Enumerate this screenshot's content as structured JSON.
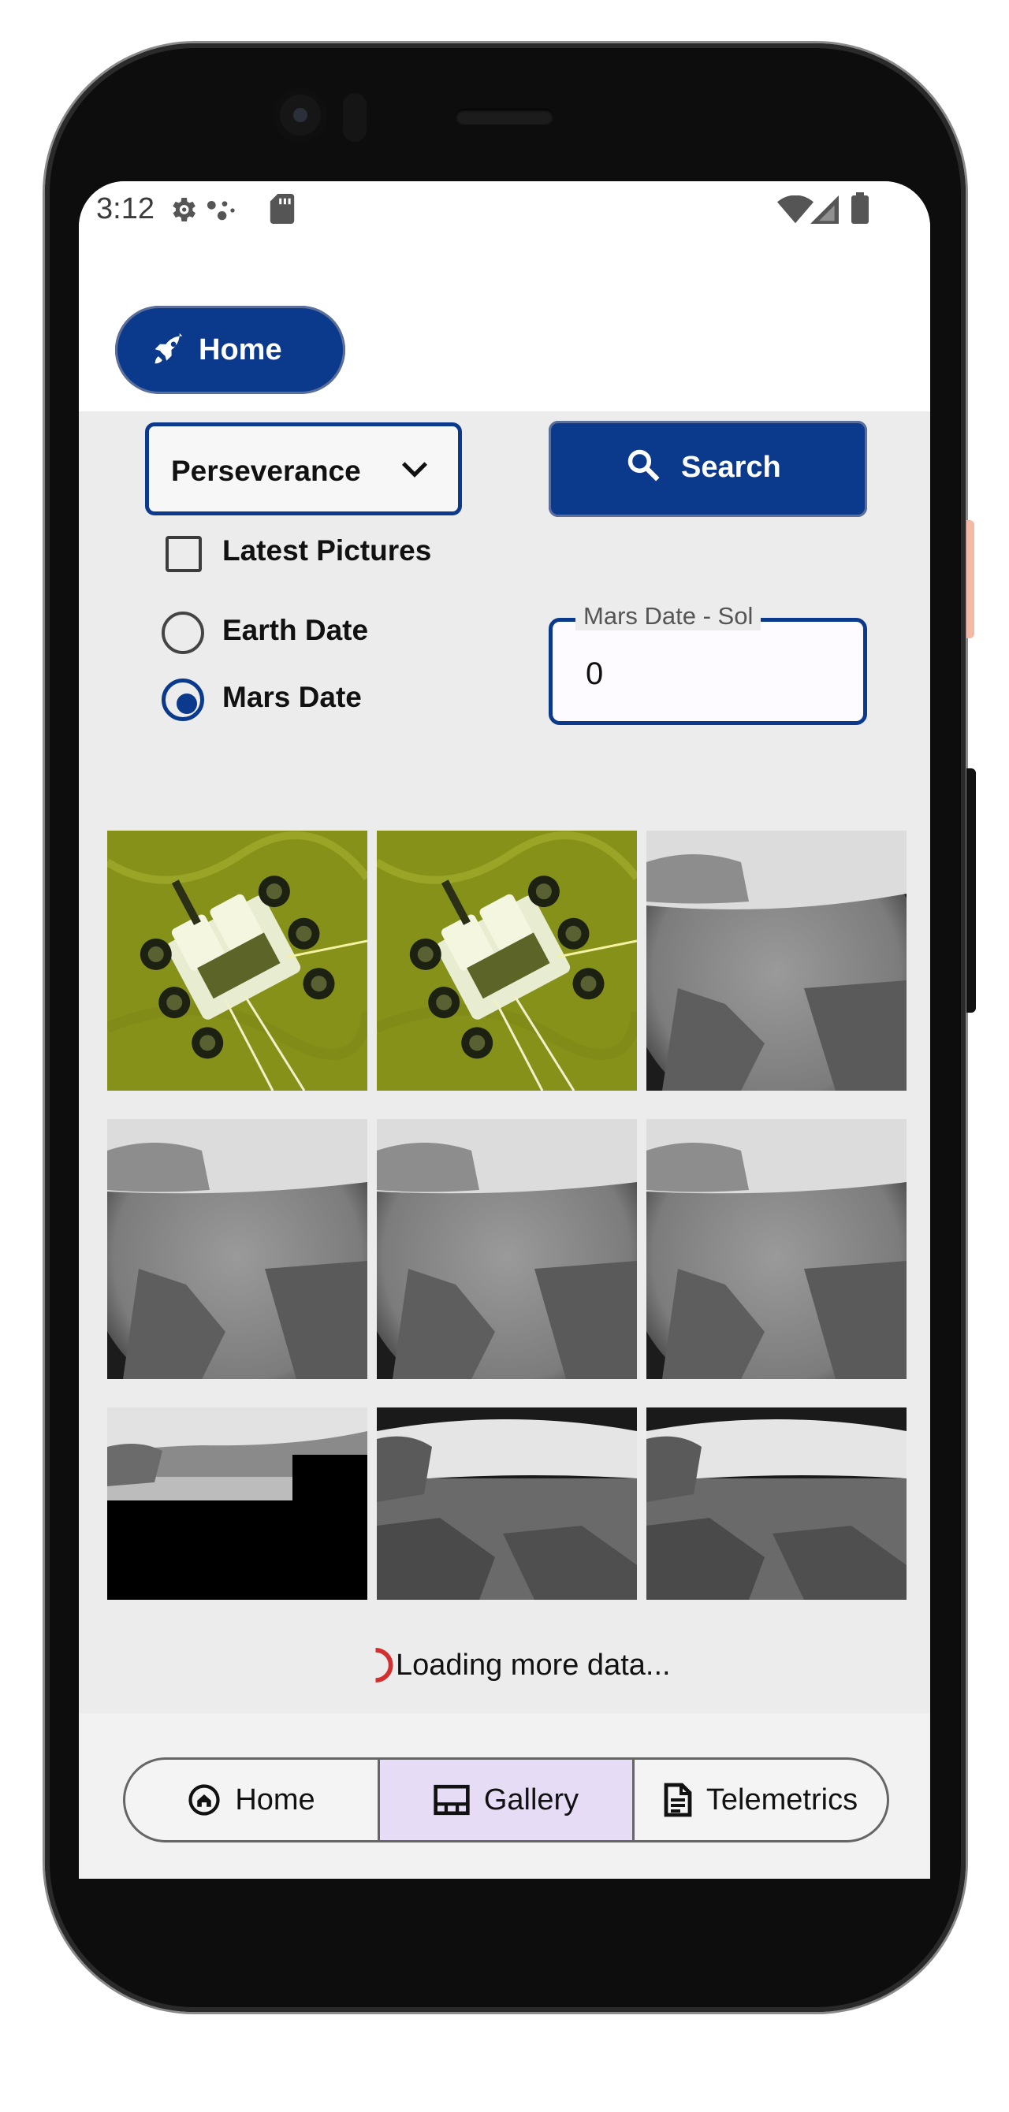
{
  "status_bar": {
    "time": "3:12"
  },
  "top_bar": {
    "home_label": "Home"
  },
  "controls": {
    "rover_selected": "Perseverance",
    "search_label": "Search",
    "latest_label": "Latest Pictures",
    "latest_checked": false,
    "radio_earth_label": "Earth Date",
    "radio_mars_label": "Mars Date",
    "radio_selected": "Mars Date",
    "sol_field_label": "Mars Date - Sol",
    "sol_value": "0"
  },
  "gallery": {
    "images": [
      {
        "kind": "rover-descent"
      },
      {
        "kind": "rover-descent"
      },
      {
        "kind": "hazcam-fisheye"
      },
      {
        "kind": "hazcam-fisheye"
      },
      {
        "kind": "hazcam-fisheye"
      },
      {
        "kind": "hazcam-fisheye"
      },
      {
        "kind": "hazcam-partial"
      },
      {
        "kind": "hazcam-wide"
      },
      {
        "kind": "hazcam-wide"
      }
    ],
    "loading_text": "Loading more data..."
  },
  "bottom_nav": {
    "items": [
      {
        "label": "Home",
        "icon": "home-icon",
        "selected": false
      },
      {
        "label": "Gallery",
        "icon": "gallery-icon",
        "selected": true
      },
      {
        "label": "Telemetrics",
        "icon": "document-icon",
        "selected": false
      }
    ]
  },
  "colors": {
    "primary": "#0b3a8c",
    "selected_segment": "#e7dcf6",
    "spinner": "#d32f2f",
    "screen_background": "#ececec"
  }
}
